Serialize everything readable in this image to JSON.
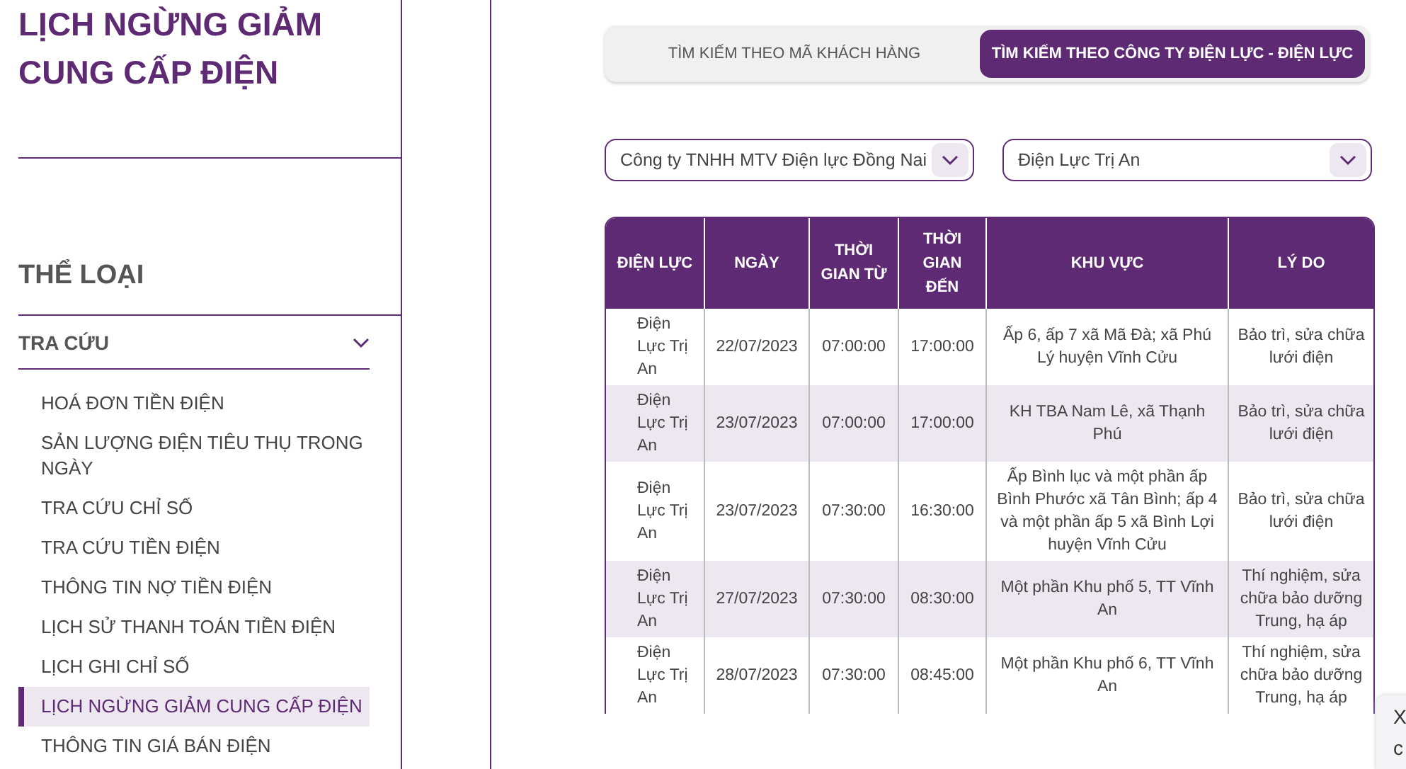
{
  "sidebar": {
    "title": "LỊCH NGỪNG GIẢM CUNG CẤP ĐIỆN",
    "section_title": "THỂ LOẠI",
    "group": {
      "label": "TRA CỨU",
      "expanded": true,
      "items": [
        {
          "label": "HOÁ ĐƠN TIỀN ĐIỆN",
          "selected": false
        },
        {
          "label": "SẢN LƯỢNG ĐIỆN TIÊU THỤ TRONG NGÀY",
          "selected": false
        },
        {
          "label": "TRA CỨU CHỈ SỐ",
          "selected": false
        },
        {
          "label": "TRA CỨU TIỀN ĐIỆN",
          "selected": false
        },
        {
          "label": "THÔNG TIN NỢ TIỀN ĐIỆN",
          "selected": false
        },
        {
          "label": "LỊCH SỬ THANH TOÁN TIỀN ĐIỆN",
          "selected": false
        },
        {
          "label": "LỊCH GHI CHỈ SỐ",
          "selected": false
        },
        {
          "label": "LỊCH NGỪNG GIẢM CUNG CẤP ĐIỆN",
          "selected": true
        },
        {
          "label": "THÔNG TIN GIÁ BÁN ĐIỆN",
          "selected": false
        }
      ]
    }
  },
  "tabs": [
    {
      "label": "TÌM KIẾM THEO MÃ KHÁCH HÀNG",
      "selected": false
    },
    {
      "label": "TÌM KIẾM THEO CÔNG TY ĐIỆN LỰC - ĐIỆN LỰC",
      "selected": true
    }
  ],
  "filters": [
    {
      "value": "Công ty TNHH MTV Điện lực Đồng Nai"
    },
    {
      "value": "Điện Lực Trị An"
    }
  ],
  "table": {
    "columns": [
      "ĐIỆN LỰC",
      "NGÀY",
      "THỜI GIAN TỪ",
      "THỜI GIAN ĐẾN",
      "KHU VỰC",
      "LÝ DO"
    ],
    "rows": [
      [
        "Điện Lực Trị An",
        "22/07/2023",
        "07:00:00",
        "17:00:00",
        "Ấp 6, ấp 7 xã Mã Đà; xã Phú Lý huyện Vĩnh Cửu",
        "Bảo trì, sửa chữa lưới điện"
      ],
      [
        "Điện Lực Trị An",
        "23/07/2023",
        "07:00:00",
        "17:00:00",
        "KH TBA Nam Lê, xã Thạnh Phú",
        "Bảo trì, sửa chữa lưới điện"
      ],
      [
        "Điện Lực Trị An",
        "23/07/2023",
        "07:30:00",
        "16:30:00",
        "Ấp Bình lục và một phần ấp Bình Phước xã Tân Bình; ấp 4 và một phần ấp 5 xã Bình Lợi huyện Vĩnh Cửu",
        "Bảo trì, sửa chữa lưới điện"
      ],
      [
        "Điện Lực Trị An",
        "27/07/2023",
        "07:30:00",
        "08:30:00",
        "Một phần Khu phố 5, TT Vĩnh An",
        "Thí nghiệm, sửa chữa bảo dưỡng Trung, hạ áp"
      ],
      [
        "Điện Lực Trị An",
        "28/07/2023",
        "07:30:00",
        "08:45:00",
        "Một phần Khu phố 6, TT Vĩnh An",
        "Thí nghiệm, sửa chữa bảo dưỡng Trung, hạ áp"
      ]
    ]
  },
  "corner_popup": {
    "line_1": "X",
    "line_2": "c"
  }
}
